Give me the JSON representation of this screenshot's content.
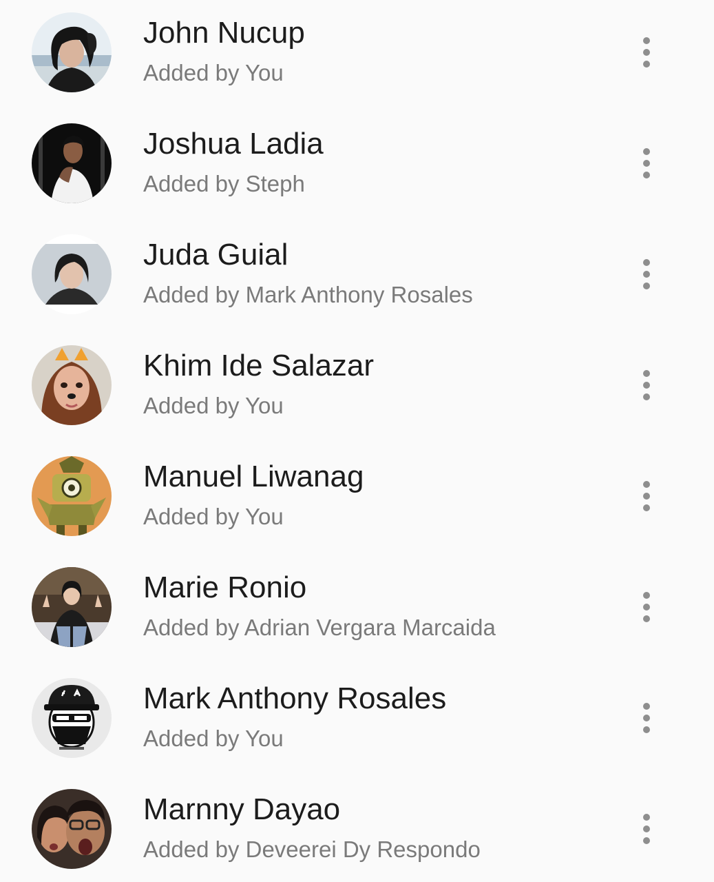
{
  "members": [
    {
      "name": "John Nucup",
      "added_by": "Added by You",
      "avatar": "photo-woman-beach",
      "more_icon": "more-vert-icon"
    },
    {
      "name": "Joshua Ladia",
      "added_by": "Added by Steph",
      "avatar": "photo-man-white-shirt",
      "more_icon": "more-vert-icon"
    },
    {
      "name": "Juda Guial",
      "added_by": "Added by Mark Anthony Rosales",
      "avatar": "photo-woman-portrait",
      "more_icon": "more-vert-icon"
    },
    {
      "name": "Khim Ide Salazar",
      "added_by": "Added by You",
      "avatar": "photo-woman-dog-filter",
      "more_icon": "more-vert-icon"
    },
    {
      "name": "Manuel Liwanag",
      "added_by": "Added by You",
      "avatar": "illustration-robot",
      "more_icon": "more-vert-icon"
    },
    {
      "name": "Marie Ronio",
      "added_by": "Added by Adrian Vergara Marcaida",
      "avatar": "photo-woman-peace-sign",
      "more_icon": "more-vert-icon"
    },
    {
      "name": "Mark Anthony Rosales",
      "added_by": "Added by You",
      "avatar": "logo-cap-masked-face",
      "more_icon": "more-vert-icon"
    },
    {
      "name": "Marnny Dayao",
      "added_by": "Added by Deveerei Dy Respondo",
      "avatar": "photo-couple-selfie",
      "more_icon": "more-vert-icon"
    }
  ],
  "colors": {
    "background": "#fafafa",
    "name_text": "#1c1c1c",
    "secondary_text": "#7a7a7a",
    "icon": "#8e8e8e"
  }
}
